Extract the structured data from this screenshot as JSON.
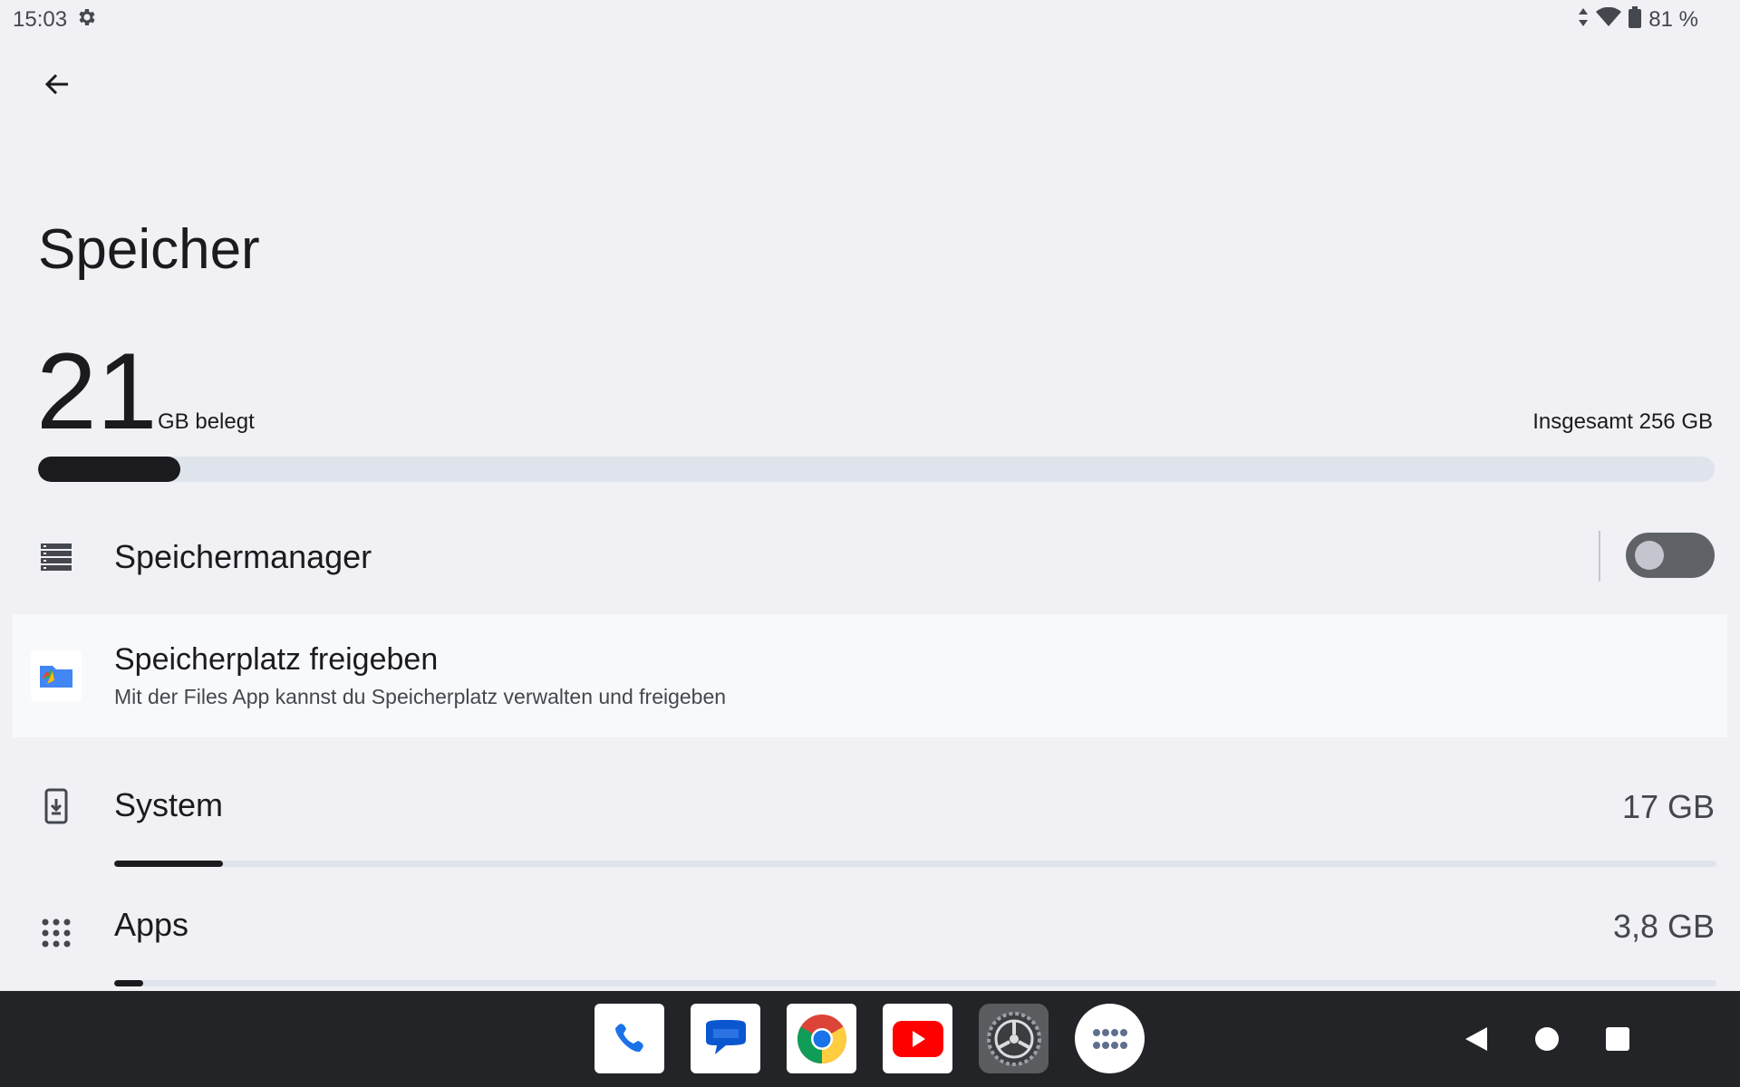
{
  "status_bar": {
    "time": "15:03",
    "battery": "81 %",
    "icons": [
      "settings-icon",
      "data-arrows-icon",
      "wifi-icon",
      "battery-icon"
    ]
  },
  "header": {
    "back_icon": "arrow-left-icon",
    "title": "Speicher"
  },
  "usage": {
    "used_value": "21",
    "used_unit": "GB belegt",
    "total": "Insgesamt 256 GB",
    "used_fraction": 0.085
  },
  "manager": {
    "label": "Speichermanager",
    "icon": "storage-list-icon",
    "enabled": false
  },
  "free_up": {
    "title": "Speicherplatz freigeben",
    "subtitle": "Mit der Files App kannst du Speicherplatz verwalten und freigeben",
    "icon": "files-app-icon"
  },
  "categories": [
    {
      "label": "System",
      "value": "17 GB",
      "icon": "system-update-icon",
      "fraction": 0.068
    },
    {
      "label": "Apps",
      "value": "3,8 GB",
      "icon": "apps-grid-icon",
      "fraction": 0.018
    }
  ],
  "dock": {
    "apps": [
      "phone-app-icon",
      "messages-app-icon",
      "chrome-app-icon",
      "youtube-app-icon",
      "settings-app-icon",
      "app-drawer-icon"
    ]
  },
  "nav_keys": [
    "nav-back-icon",
    "nav-home-icon",
    "nav-recents-icon"
  ],
  "colors": {
    "background": "#f0f0f5",
    "accent_dark": "#1b1b1f",
    "track": "#dfe3eb",
    "nav_bar": "#232427"
  }
}
